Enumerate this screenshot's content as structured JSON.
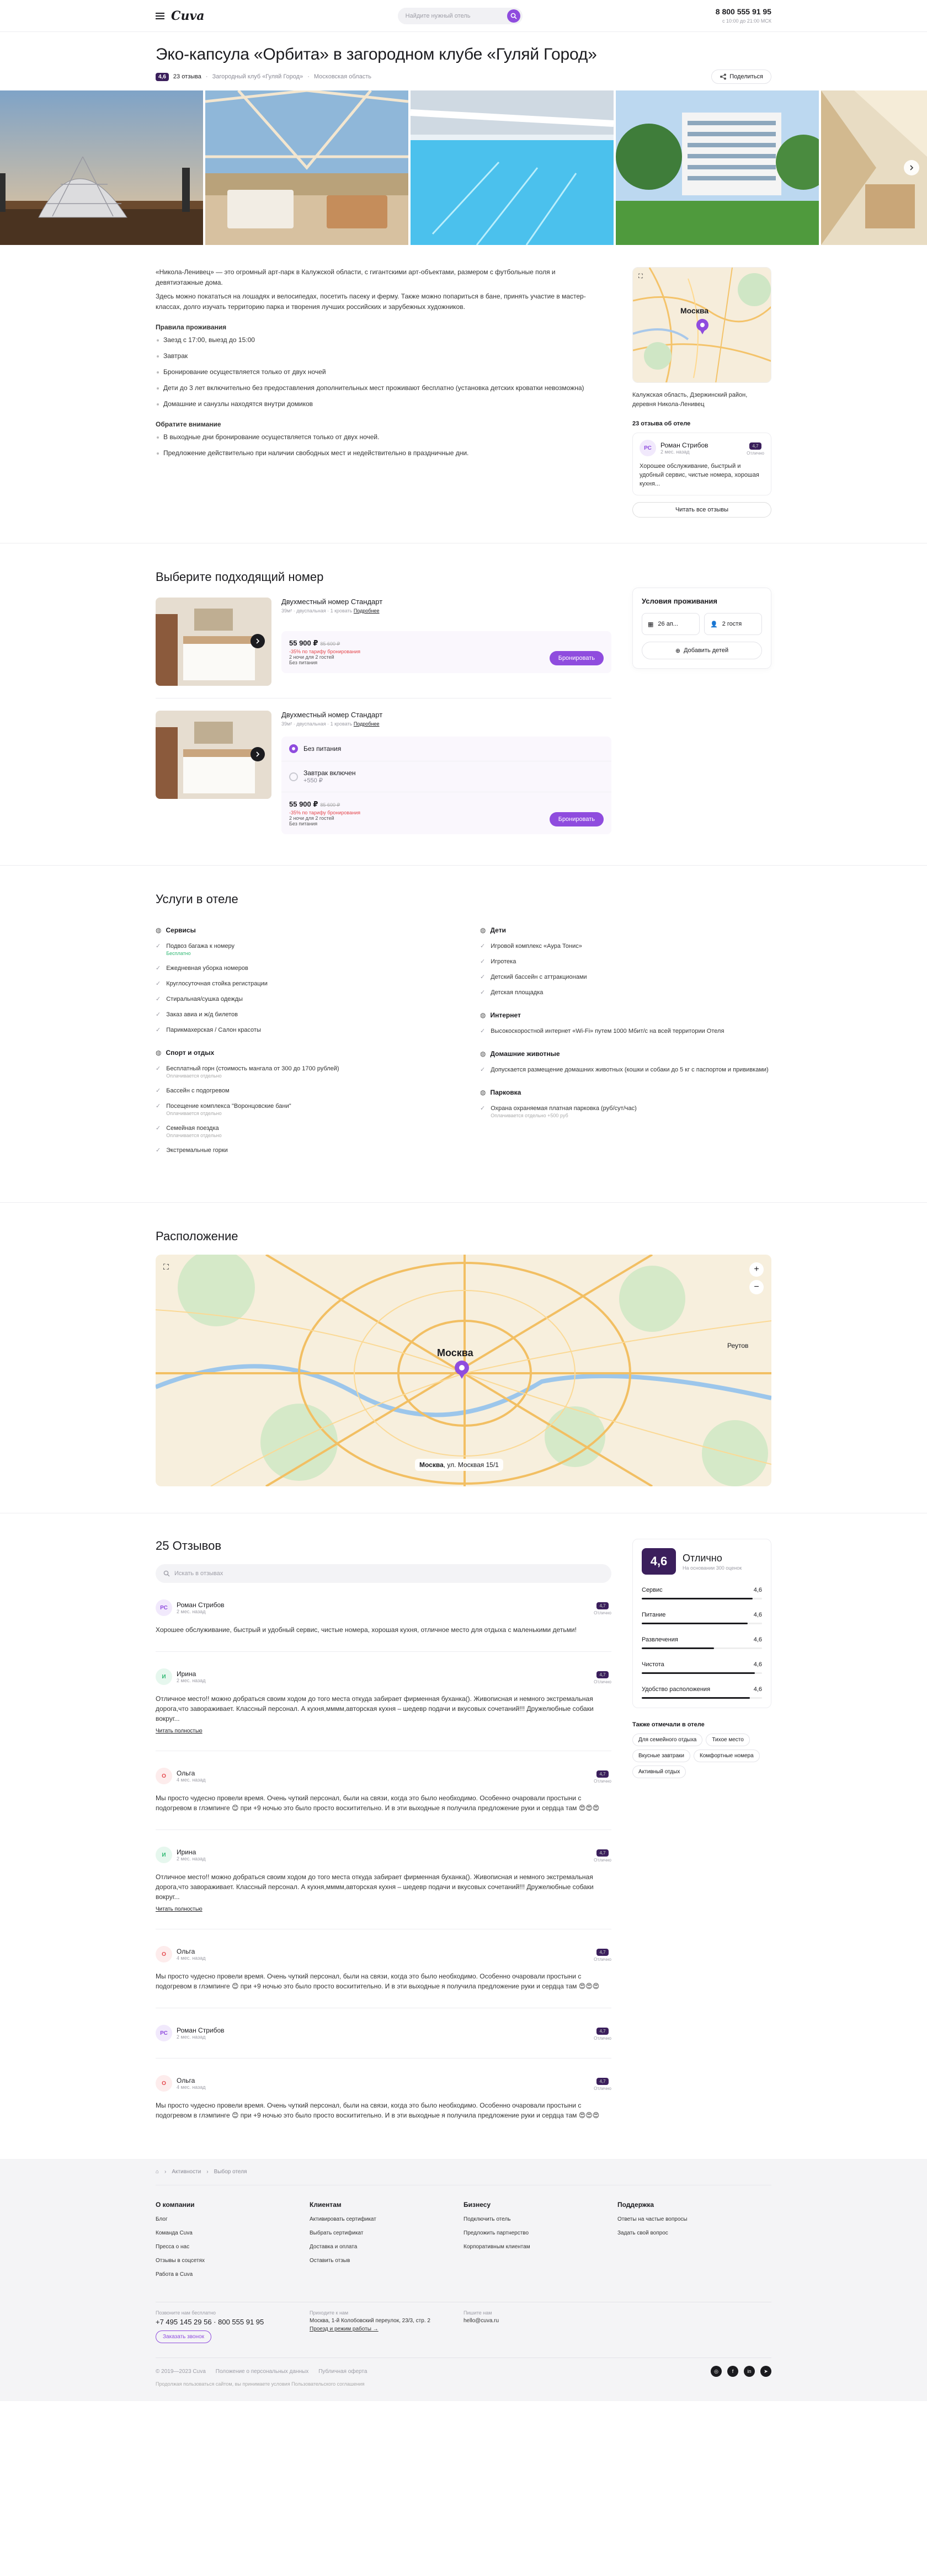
{
  "header": {
    "logo": "Cuva",
    "search_placeholder": "Найдите нужный отель",
    "phone": "8 800 555 91 95",
    "phone_hours": "с 10:00 до 21:00 МСК"
  },
  "hotel": {
    "title": "Эко-капсула «Орбита» в загородном клубе «Гуляй Город»",
    "rating": "4,6",
    "reviews_link": "23 отзыва",
    "breadcrumb_1": "Загородный клуб «Гуляй Город»",
    "breadcrumb_2": "Московская область",
    "share": "Поделиться"
  },
  "intro": {
    "p1": "«Никола-Ленивец» — это огромный арт-парк в Калужской области, с гигантскими арт-объектами, размером с футбольные поля и девятиэтажные дома.",
    "p2": "Здесь можно покататься на лошадях и велосипедах, посетить пасеку и ферму. Также можно попариться в бане, принять участие в мастер-классах, долго изучать территорию парка и творения лучших российских и зарубежных художников.",
    "rules_title": "Правила проживания",
    "rules": [
      "Заезд с 17:00, выезд до 15:00",
      "Завтрак",
      "Бронирование осуществляется только от двух ночей",
      "Дети до 3 лет включительно без предоставления дополнительных мест проживают бесплатно (установка детских кроватки невозможна)",
      "Домашние и санузлы находятся внутри домиков"
    ],
    "attention_title": "Обратите внимание",
    "attention": [
      "В выходные дни бронирование осуществляется только от двух ночей.",
      "Предложение действительно при наличии свободных мест и недействительно в праздничные дни."
    ]
  },
  "side": {
    "map_city": "Москва",
    "address": "Калужская область, Дзержинский район, деревня Никола-Ленивец",
    "reviews_count": "23 отзыва об отеле",
    "review": {
      "initials": "РС",
      "name": "Роман Стрибов",
      "date": "2 мес. назад",
      "score": "4,7",
      "score_label": "Отлично",
      "text": "Хорошее обслуживание, быстрый и удобный сервис, чистые номера, хорошая кухня..."
    },
    "all_reviews": "Читать все отзывы"
  },
  "rooms": {
    "title": "Выберите подходящий номер",
    "items": [
      {
        "name": "Двухместный номер Стандарт",
        "meta": "39м² · двуспальная · 1 кровать",
        "more": "Подробнее",
        "price": "55 900 ₽",
        "old_price": "85 600 ₽",
        "discount": "-35% по тарифу бронирования",
        "nights": "2 ночи для 2 гостей",
        "meal": "Без питания",
        "book": "Бронировать"
      },
      {
        "name": "Двухместный номер Стандарт",
        "meta": "39м² · двуспальная · 1 кровать",
        "more": "Подробнее",
        "opt1": "Без питания",
        "opt2": "Завтрак включен",
        "opt2_sub": "+550 ₽",
        "price": "55 900 ₽",
        "old_price": "85 600 ₽",
        "discount": "-35% по тарифу бронирования",
        "nights": "2 ночи для 2 гостей",
        "meal": "Без питания",
        "book": "Бронировать"
      }
    ],
    "conditions": {
      "title": "Условия проживания",
      "dates": "26 ап...",
      "guests": "2 гостя",
      "add_kids": "Добавить детей"
    }
  },
  "services": {
    "title": "Услуги в отеле",
    "col1": [
      {
        "title": "Сервисы",
        "icon": "bell-icon",
        "items": [
          {
            "t": "Подвоз багажа к номеру",
            "s": "Бесплатно",
            "green": true
          },
          {
            "t": "Ежедневная уборка номеров"
          },
          {
            "t": "Круглосуточная стойка регистрации"
          },
          {
            "t": "Стиральная/сушка одежды"
          },
          {
            "t": "Заказ авиа и ж/д билетов"
          },
          {
            "t": "Парикмахерская / Салон красоты"
          }
        ]
      },
      {
        "title": "Спорт и отдых",
        "icon": "sport-icon",
        "items": [
          {
            "t": "Бесплатный горн (стоимость мангала от 300 до 1700 рублей)",
            "s": "Оплачивается отдельно"
          },
          {
            "t": "Бассейн с подогревом"
          },
          {
            "t": "Посещение комплекса \"Воронцовские бани\"",
            "s": "Оплачивается отдельно"
          },
          {
            "t": "Семейная поездка",
            "s": "Оплачивается отдельно"
          },
          {
            "t": "Экстремальные горки"
          }
        ]
      }
    ],
    "col2": [
      {
        "title": "Дети",
        "icon": "child-icon",
        "items": [
          {
            "t": "Игровой комплекс «Аура Тонис»"
          },
          {
            "t": "Игротека"
          },
          {
            "t": "Детский бассейн с аттракционами"
          },
          {
            "t": "Детская площадка"
          }
        ]
      },
      {
        "title": "Интернет",
        "icon": "wifi-icon",
        "items": [
          {
            "t": "Высокоскоростной интернет «Wi-Fi» путем 1000 Мбит/с на всей территории Отеля"
          }
        ]
      },
      {
        "title": "Домашние животные",
        "icon": "paw-icon",
        "items": [
          {
            "t": "Допускается размещение домашних животных (кошки и собаки до 5 кг с паспортом и прививками)"
          }
        ]
      },
      {
        "title": "Парковка",
        "icon": "parking-icon",
        "items": [
          {
            "t": "Охрана охраняемая платная парковка (руб/сут/час)",
            "s": "Оплачивается отдельно +500 руб"
          }
        ]
      }
    ]
  },
  "location": {
    "title": "Расположение",
    "city": "Москва",
    "city2": "Реутов",
    "address_bold": "Москва",
    "address_rest": ", ул. Москвая 15/1"
  },
  "reviews": {
    "title": "25 Отзывов",
    "search_placeholder": "Искать в отзывах",
    "read_more": "Читать полностью",
    "items": [
      {
        "initials": "РС",
        "name": "Роман Стрибов",
        "date": "2 мес. назад",
        "score": "4,7",
        "label": "Отлично",
        "text": "Хорошее обслуживание, быстрый и удобный сервис, чистые номера, хорошая кухня, отличное место для отдыха с маленькими детьми!",
        "more": false,
        "color": "#f1e9fc",
        "fg": "#8f4cde"
      },
      {
        "initials": "И",
        "name": "Ирина",
        "date": "2 мес. назад",
        "score": "4,7",
        "label": "Отлично",
        "text": "Отличное место!! можно добраться своим ходом до того места откуда забирает фирменная буханка(). Живописная и немного экстремальная дорога,что завораживает. Классный персонал. А кухня,мммм,авторская кухня – шедевр подачи и вкусовых сочетаний!!! Дружелюбные собаки вокруг...",
        "more": true,
        "color": "#e6f7ee",
        "fg": "#2eb872"
      },
      {
        "initials": "О",
        "name": "Ольга",
        "date": "4 мес. назад",
        "score": "4,7",
        "label": "Отлично",
        "text": "Мы просто чудесно провели время. Очень чуткий персонал, были на связи, когда это было необходимо. Особенно очаровали простыни с подогревом в глэмпинге 😊 при +9 ночью это было просто восхитительно. И в эти выходные я получила предложение руки и сердца там 😍😍😍",
        "more": false,
        "color": "#fdecec",
        "fg": "#e5484d"
      },
      {
        "initials": "И",
        "name": "Ирина",
        "date": "2 мес. назад",
        "score": "4,7",
        "label": "Отлично",
        "text": "Отличное место!! можно добраться своим ходом до того места откуда забирает фирменная буханка(). Живописная и немного экстремальная дорога,что завораживает. Классный персонал. А кухня,мммм,авторская кухня – шедевр подачи и вкусовых сочетаний!!! Дружелюбные собаки вокруг...",
        "more": true,
        "color": "#e6f7ee",
        "fg": "#2eb872"
      },
      {
        "initials": "О",
        "name": "Ольга",
        "date": "4 мес. назад",
        "score": "4,7",
        "label": "Отлично",
        "text": "Мы просто чудесно провели время. Очень чуткий персонал, были на связи, когда это было необходимо. Особенно очаровали простыни с подогревом в глэмпинге 😊 при +9 ночью это было просто восхитительно. И в эти выходные я получила предложение руки и сердца там 😍😍😍",
        "more": false,
        "color": "#fdecec",
        "fg": "#e5484d"
      },
      {
        "initials": "РС",
        "name": "Роман Стрибов",
        "date": "2 мес. назад",
        "score": "4,7",
        "label": "Отлично",
        "text": "",
        "more": false,
        "color": "#f1e9fc",
        "fg": "#8f4cde"
      },
      {
        "initials": "О",
        "name": "Ольга",
        "date": "4 мес. назад",
        "score": "4,7",
        "label": "Отлично",
        "text": "Мы просто чудесно провели время. Очень чуткий персонал, были на связи, когда это было необходимо. Особенно очаровали простыни с подогревом в глэмпинге 😊 при +9 ночью это было просто восхитительно. И в эти выходные я получила предложение руки и сердца там 😍😍😍",
        "more": false,
        "color": "#fdecec",
        "fg": "#e5484d"
      }
    ],
    "summary": {
      "score": "4,6",
      "label": "Отлично",
      "basis": "На основании 300 оценок",
      "criteria": [
        {
          "name": "Сервис",
          "value": "4,6",
          "fill": 0.92
        },
        {
          "name": "Питание",
          "value": "4,6",
          "fill": 0.88
        },
        {
          "name": "Развлечения",
          "value": "4,6",
          "fill": 0.6
        },
        {
          "name": "Чистота",
          "value": "4,6",
          "fill": 0.94
        },
        {
          "name": "Удобство расположения",
          "value": "4,6",
          "fill": 0.9
        }
      ],
      "tags_title": "Также отмечали в отеле",
      "tags": [
        "Для семейного отдыха",
        "Тихое место",
        "Вкусные завтраки",
        "Комфортные номера",
        "Активный отдых"
      ]
    }
  },
  "footer": {
    "bread_1": "Активности",
    "bread_2": "Выбор отеля",
    "cols": [
      {
        "title": "О компании",
        "items": [
          "Блог",
          "Команда Cuva",
          "Пресса о нас",
          "Отзывы в соцсетях",
          "Работа в Cuva"
        ]
      },
      {
        "title": "Клиентам",
        "items": [
          "Активировать сертификат",
          "Выбрать сертификат",
          "Доставка и оплата",
          "Оставить отзыв"
        ]
      },
      {
        "title": "Бизнесу",
        "items": [
          "Подключить отель",
          "Предложить партнерство",
          "Корпоративным клиентам"
        ]
      },
      {
        "title": "Поддержка",
        "items": [
          "Ответы на частые вопросы",
          "Задать свой вопрос"
        ]
      }
    ],
    "contact_label": "Позвоните нам бесплатно",
    "contact_phones": "+7 495 145 29 56 · 800 555 91 95",
    "call_button": "Заказать звонок",
    "address_label": "Приходите к нам",
    "address": "Москва, 1-й Колобовский переулок, 23/3, стр. 2",
    "route": "Проезд и режим работы →",
    "email_label": "Пишите нам",
    "email": "hello@cuva.ru",
    "copyright": "© 2019—2023 Cuva",
    "policy_1": "Положение о персональных данных",
    "policy_2": "Публичная оферта",
    "note": "Продолжая пользоваться сайтом, вы принимаете условия Пользовательского соглашения"
  }
}
